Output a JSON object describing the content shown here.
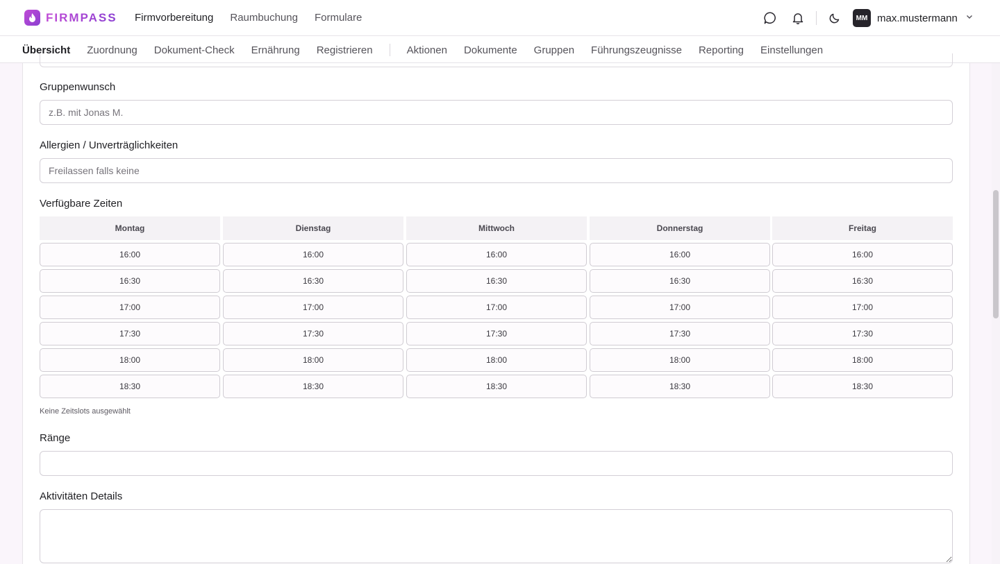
{
  "app": {
    "name": "FIRMPASS"
  },
  "main_nav": [
    {
      "label": "Firmvorbereitung",
      "active": true
    },
    {
      "label": "Raumbuchung",
      "active": false
    },
    {
      "label": "Formulare",
      "active": false
    }
  ],
  "header_icons": [
    "chat-icon",
    "bell-icon",
    "moon-icon"
  ],
  "user": {
    "initials": "MM",
    "name": "max.mustermann"
  },
  "sub_nav": {
    "primary": [
      {
        "label": "Übersicht",
        "active": true
      },
      {
        "label": "Zuordnung",
        "active": false
      },
      {
        "label": "Dokument-Check",
        "active": false
      },
      {
        "label": "Ernährung",
        "active": false
      },
      {
        "label": "Registrieren",
        "active": false
      }
    ],
    "secondary": [
      {
        "label": "Aktionen"
      },
      {
        "label": "Dokumente"
      },
      {
        "label": "Gruppen"
      },
      {
        "label": "Führungszeugnisse"
      },
      {
        "label": "Reporting"
      },
      {
        "label": "Einstellungen"
      }
    ]
  },
  "form": {
    "group_wish": {
      "label": "Gruppenwunsch",
      "placeholder": "z.B. mit Jonas M.",
      "value": ""
    },
    "allergies": {
      "label": "Allergien / Unverträglichkeiten",
      "placeholder": "Freilassen falls keine",
      "value": ""
    },
    "times": {
      "label": "Verfügbare Zeiten",
      "days": [
        "Montag",
        "Dienstag",
        "Mittwoch",
        "Donnerstag",
        "Freitag"
      ],
      "slots": [
        "16:00",
        "16:30",
        "17:00",
        "17:30",
        "18:00",
        "18:30"
      ],
      "helper": "Keine Zeitslots ausgewählt"
    },
    "ranks": {
      "label": "Ränge",
      "value": ""
    },
    "activities": {
      "label": "Aktivitäten Details",
      "value": ""
    }
  },
  "colors": {
    "brand": "#b146d3",
    "accent_dark": "#1f1f23"
  }
}
